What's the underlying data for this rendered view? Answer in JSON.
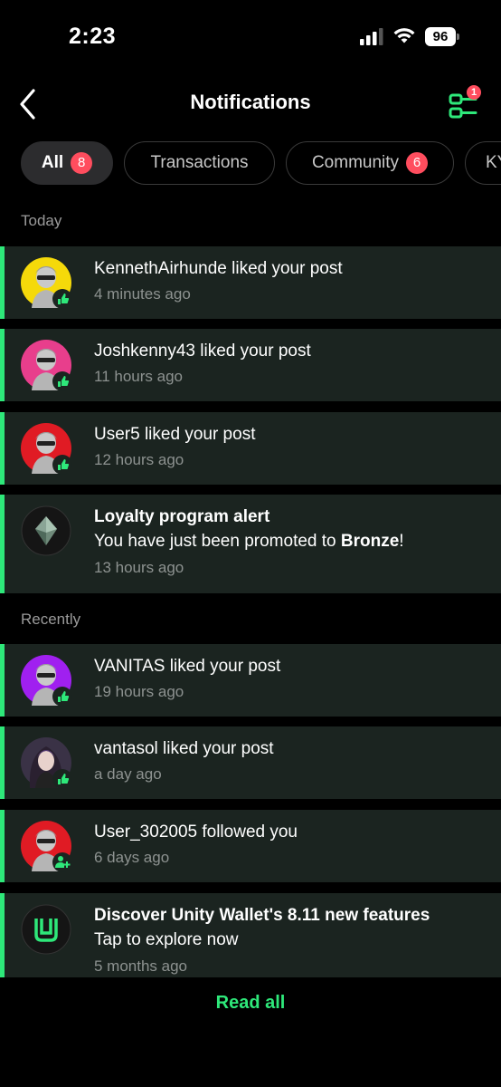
{
  "status_bar": {
    "time": "2:23",
    "battery": "96"
  },
  "header": {
    "title": "Notifications",
    "filter_badge": "1"
  },
  "tabs": [
    {
      "label": "All",
      "badge": "8",
      "active": true
    },
    {
      "label": "Transactions",
      "badge": ""
    },
    {
      "label": "Community",
      "badge": "6"
    },
    {
      "label": "KY"
    }
  ],
  "sections": [
    {
      "label": "Today"
    },
    {
      "label": "Recently"
    }
  ],
  "notifications": [
    {
      "title": "KennethAirhunde liked your post",
      "time": "4 minutes ago",
      "avatar_color": "#f5d90a",
      "badge_icon": "thumbs-up-icon"
    },
    {
      "title": "Joshkenny43 liked your post",
      "time": "11 hours ago",
      "avatar_color": "#e83e8c",
      "badge_icon": "thumbs-up-icon"
    },
    {
      "title": "User5 liked your post",
      "time": "12 hours ago",
      "avatar_color": "#e01b24",
      "badge_icon": "thumbs-up-icon"
    },
    {
      "title": "Loyalty program alert",
      "body_prefix": "You have just been promoted to ",
      "body_bold": "Bronze",
      "body_suffix": "!",
      "time": "13 hours ago",
      "icon": "diamond-icon"
    },
    {
      "title": "VANITAS liked your post",
      "time": "19 hours ago",
      "avatar_color": "#a020f0",
      "badge_icon": "thumbs-up-icon"
    },
    {
      "title": "vantasol liked your post",
      "time": "a day ago",
      "avatar_color": "#8a7aa0",
      "badge_icon": "thumbs-up-icon"
    },
    {
      "title": "User_302005 followed you",
      "time": "6 days ago",
      "avatar_color": "#e01b24",
      "badge_icon": "user-plus-icon"
    },
    {
      "title": "Discover Unity Wallet's 8.11 new features",
      "body": "Tap to explore now",
      "time": "5 months ago",
      "icon": "unity-wallet-logo-icon"
    }
  ],
  "read_all": "Read all",
  "colors": {
    "accent": "#2ee87a",
    "badge": "#ff4d5e",
    "card": "#1b2420",
    "background": "#000000"
  }
}
